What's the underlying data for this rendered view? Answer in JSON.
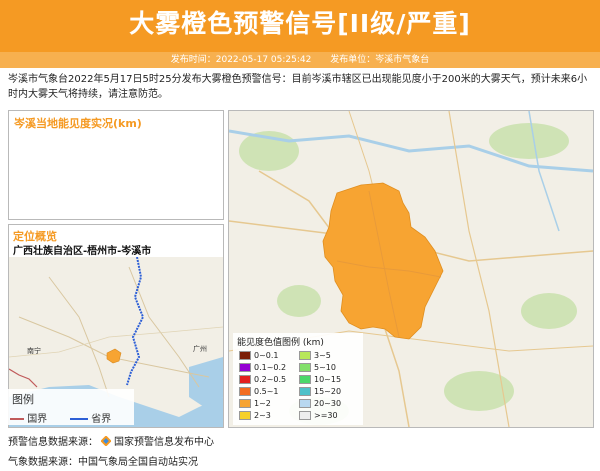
{
  "header": {
    "title": "大雾橙色预警信号[II级/严重]",
    "publish_time_label": "发布时间：2022-05-17 05:25:42",
    "publish_unit_label": "发布单位：岑溪市气象台"
  },
  "description": "岑溪市气象台2022年5月17日5时25分发布大雾橙色预警信号：目前岑溪市辖区已出现能见度小于200米的大雾天气，预计未来6小时内大雾天气将持续，请注意防范。",
  "visibility_panel": {
    "title": "岑溪当地能见度实况(km)"
  },
  "location_panel": {
    "title": "定位概览",
    "path": "广西壮族自治区-梧州市-岑溪市",
    "map_labels": {
      "nanning": "南宁",
      "guangzhou": "广州"
    },
    "legend": {
      "title": "图例",
      "national_border": "国界",
      "provincial_border": "省界"
    }
  },
  "main_map": {
    "legend_title": "能见度色值图例 (km)",
    "legend_items": [
      {
        "label": "0~0.1",
        "color": "#7b1e07"
      },
      {
        "label": "0.1~0.2",
        "color": "#9400d3"
      },
      {
        "label": "0.2~0.5",
        "color": "#e31f1f"
      },
      {
        "label": "0.5~1",
        "color": "#f36c20"
      },
      {
        "label": "1~2",
        "color": "#f7a432"
      },
      {
        "label": "2~3",
        "color": "#f6d12a"
      },
      {
        "label": "3~5",
        "color": "#b8e85a"
      },
      {
        "label": "5~10",
        "color": "#82e06a"
      },
      {
        "label": "10~15",
        "color": "#4bd86a"
      },
      {
        "label": "15~20",
        "color": "#4ec1c9"
      },
      {
        "label": "20~30",
        "color": "#b8d8f0"
      },
      {
        "label": ">=30",
        "color": "#eeeeee"
      }
    ],
    "region_color": "#f7a432"
  },
  "sources": {
    "warning_source": "预警信息数据来源：",
    "warning_source_name": "国家预警信息发布中心",
    "weather_source": "气象数据来源：中国气象局全国自动站实况"
  },
  "colors": {
    "accent": "#f59a23",
    "accent_light": "#f7b04f"
  }
}
